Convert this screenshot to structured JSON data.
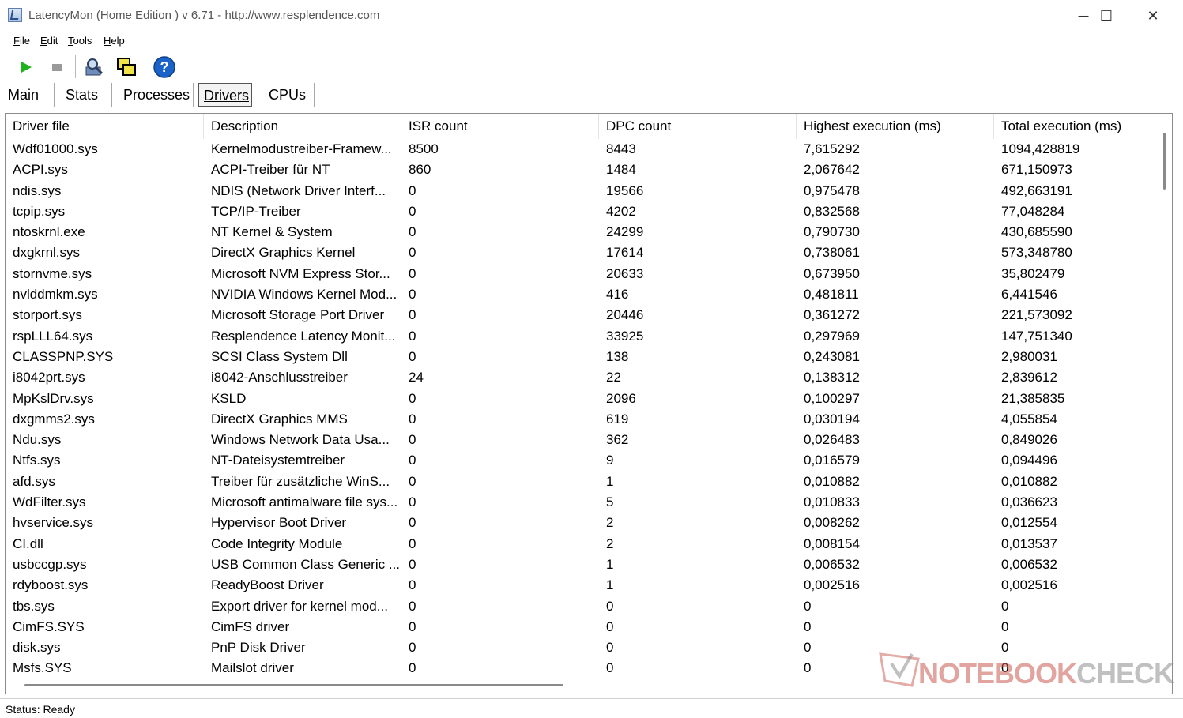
{
  "window": {
    "title": "LatencyMon  (Home Edition )  v 6.71 - http://www.resplendence.com",
    "minimize_glyph": "─",
    "maximize_glyph": "☐",
    "close_glyph": "✕"
  },
  "menu": {
    "file": {
      "accel": "F",
      "rest": "ile"
    },
    "edit": {
      "accel": "E",
      "rest": "dit"
    },
    "tools": {
      "accel": "T",
      "rest": "ools"
    },
    "help": {
      "accel": "H",
      "rest": "elp"
    }
  },
  "toolbar": {
    "icons": [
      "play-icon",
      "stop-icon",
      "search-tool-icon",
      "windows-icon",
      "help-icon"
    ],
    "colors": {
      "play": "#1fb31f",
      "stop": "#9a9a9a",
      "help": "#1b63c9"
    }
  },
  "tabs": {
    "main": "Main",
    "stats": "Stats",
    "processes": "Processes",
    "drivers": "Drivers",
    "cpus": "CPUs",
    "active": "drivers"
  },
  "table": {
    "columns": [
      "Driver file",
      "Description",
      "ISR count",
      "DPC count",
      "Highest execution (ms)",
      "Total execution (ms)"
    ],
    "rows": [
      [
        "Wdf01000.sys",
        "Kernelmodustreiber-Framew...",
        "8500",
        "8443",
        "7,615292",
        "1094,428819"
      ],
      [
        "ACPI.sys",
        "ACPI-Treiber für NT",
        "860",
        "1484",
        "2,067642",
        "671,150973"
      ],
      [
        "ndis.sys",
        "NDIS (Network Driver Interf...",
        "0",
        "19566",
        "0,975478",
        "492,663191"
      ],
      [
        "tcpip.sys",
        "TCP/IP-Treiber",
        "0",
        "4202",
        "0,832568",
        "77,048284"
      ],
      [
        "ntoskrnl.exe",
        "NT Kernel & System",
        "0",
        "24299",
        "0,790730",
        "430,685590"
      ],
      [
        "dxgkrnl.sys",
        "DirectX Graphics Kernel",
        "0",
        "17614",
        "0,738061",
        "573,348780"
      ],
      [
        "stornvme.sys",
        "Microsoft NVM Express Stor...",
        "0",
        "20633",
        "0,673950",
        "35,802479"
      ],
      [
        "nvlddmkm.sys",
        "NVIDIA Windows Kernel Mod...",
        "0",
        "416",
        "0,481811",
        "6,441546"
      ],
      [
        "storport.sys",
        "Microsoft Storage Port Driver",
        "0",
        "20446",
        "0,361272",
        "221,573092"
      ],
      [
        "rspLLL64.sys",
        "Resplendence Latency Monit...",
        "0",
        "33925",
        "0,297969",
        "147,751340"
      ],
      [
        "CLASSPNP.SYS",
        "SCSI Class System Dll",
        "0",
        "138",
        "0,243081",
        "2,980031"
      ],
      [
        "i8042prt.sys",
        "i8042-Anschlusstreiber",
        "24",
        "22",
        "0,138312",
        "2,839612"
      ],
      [
        "MpKslDrv.sys",
        "KSLD",
        "0",
        "2096",
        "0,100297",
        "21,385835"
      ],
      [
        "dxgmms2.sys",
        "DirectX Graphics MMS",
        "0",
        "619",
        "0,030194",
        "4,055854"
      ],
      [
        "Ndu.sys",
        "Windows Network Data Usa...",
        "0",
        "362",
        "0,026483",
        "0,849026"
      ],
      [
        "Ntfs.sys",
        "NT-Dateisystemtreiber",
        "0",
        "9",
        "0,016579",
        "0,094496"
      ],
      [
        "afd.sys",
        "Treiber für zusätzliche WinS...",
        "0",
        "1",
        "0,010882",
        "0,010882"
      ],
      [
        "WdFilter.sys",
        "Microsoft antimalware file sys...",
        "0",
        "5",
        "0,010833",
        "0,036623"
      ],
      [
        "hvservice.sys",
        "Hypervisor Boot Driver",
        "0",
        "2",
        "0,008262",
        "0,012554"
      ],
      [
        "CI.dll",
        "Code Integrity Module",
        "0",
        "2",
        "0,008154",
        "0,013537"
      ],
      [
        "usbccgp.sys",
        "USB Common Class Generic ...",
        "0",
        "1",
        "0,006532",
        "0,006532"
      ],
      [
        "rdyboost.sys",
        "ReadyBoost Driver",
        "0",
        "1",
        "0,002516",
        "0,002516"
      ],
      [
        "tbs.sys",
        "Export driver for kernel mod...",
        "0",
        "0",
        "0",
        "0"
      ],
      [
        "CimFS.SYS",
        "CimFS driver",
        "0",
        "0",
        "0",
        "0"
      ],
      [
        "disk.sys",
        "PnP Disk Driver",
        "0",
        "0",
        "0",
        "0"
      ],
      [
        "Msfs.SYS",
        "Mailslot driver",
        "0",
        "0",
        "0",
        "0"
      ]
    ]
  },
  "status": {
    "text": "Status: Ready"
  },
  "watermark": {
    "part1": "NOTEBOOK",
    "part2": "CHECK"
  }
}
